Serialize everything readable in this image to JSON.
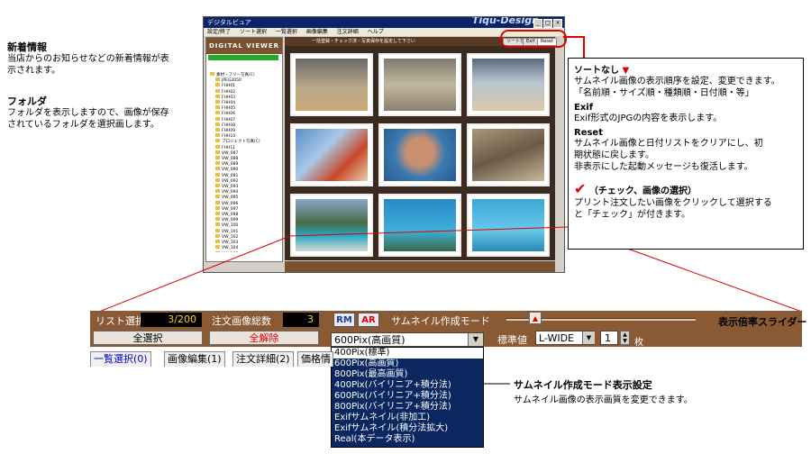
{
  "left_notes": {
    "news_title": "新着情報",
    "news_body_1": "当店からのお知らせなどの新着情報が表",
    "news_body_2": "示されます。",
    "folder_title": "フォルダ",
    "folder_body_1": "フォルダを表示しますので、画像が保存",
    "folder_body_2": "されているフォルダを選択画します。"
  },
  "window": {
    "title": "デジタルビュア",
    "brand": "Tiqu-Design",
    "menu": [
      "設定/終了",
      "ソート選択",
      "一覧選択",
      "画像編集",
      "注文詳細",
      "ヘルプ"
    ],
    "logo": "DIGITAL VIEWER",
    "top_strip": "一括登録・チェック済・写真保存を設定して下さい",
    "toolbar_sort": "ソートなし",
    "toolbar_exif": "Exif",
    "toolbar_reset": "Reset",
    "tree_items": [
      "素材・フリー写真(C)",
      "JPEG2050",
      "FHH01",
      "FHH02",
      "FHH03",
      "FHH04",
      "FHH05",
      "FHH06",
      "FHH07",
      "FHH08",
      "FHH09",
      "FHH10",
      "プロジェクト写真(C)",
      "FHH11",
      "VW_087",
      "VW_088",
      "VW_089",
      "VW_090",
      "VW_091",
      "VW_092",
      "VW_093",
      "VW_094",
      "VW_095",
      "VW_096",
      "VW_097",
      "VW_098",
      "VW_099",
      "VW_100",
      "VW_101",
      "VW_102",
      "VW_103",
      "VW_104",
      "VW_105",
      "VW_106",
      "VW_107",
      "VW_108"
    ]
  },
  "toolbar": {
    "list_select_label": "リスト選択",
    "list_select_value": "3/200",
    "order_count_label": "注文画像総数",
    "order_count_value": "3",
    "rm_button": "RM",
    "ar_button": "AR",
    "thumb_mode_label": "サムネイル作成モード",
    "select_all_button": "全選択",
    "clear_all_button": "全解除",
    "thumb_mode_value": "600Pix(高画質)",
    "standard_label": "標準値",
    "wide_value": "L-WIDE",
    "count_value": "1",
    "count_unit": "枚"
  },
  "tabs": [
    "一覧選択(0)",
    "画像編集(1)",
    "注文詳細(2)",
    "価格情"
  ],
  "dropdown_options": [
    "400Pix(標準)",
    "600Pix(高画質)",
    "800Pix(最高画質)",
    "400Pix(バイリニア+積分法)",
    "600Pix(バイリニア+積分法)",
    "800Pix(バイリニア+積分法)",
    "Exifサムネイル(非加工)",
    "Exifサムネイル(積分法拡大)",
    "Real(本データ表示)"
  ],
  "annotations": {
    "sort_title": "ソートなし",
    "sort_body_1": "サムネイル画像の表示順序を設定、変更できます。",
    "sort_body_2": "「名前順・サイズ順・種類順・日付順・等」",
    "exif_title": "Exif",
    "exif_body": "Exif形式のJPGの内容を表示します。",
    "reset_title": "Reset",
    "reset_body_1": "サムネイル画像と日付リストをクリアにし、初",
    "reset_body_2": "期状態に戻します。",
    "reset_body_3": "非表示にした起動メッセージも復活します。",
    "check_title": "（チェック、画像の選択）",
    "check_body_1": "プリント注文したい画像をクリックして選択する",
    "check_body_2": "と「チェック」が付きます。",
    "zoom_slider": "表示倍率スライダー",
    "thumb_mode_title": "サムネイル作成モード表示設定",
    "thumb_mode_body": "サムネイル画像の表示画質を変更できます。"
  },
  "colors": {
    "brown": "#8a5a35",
    "accent_red": "#dd0000",
    "navy": "#0a2760"
  }
}
